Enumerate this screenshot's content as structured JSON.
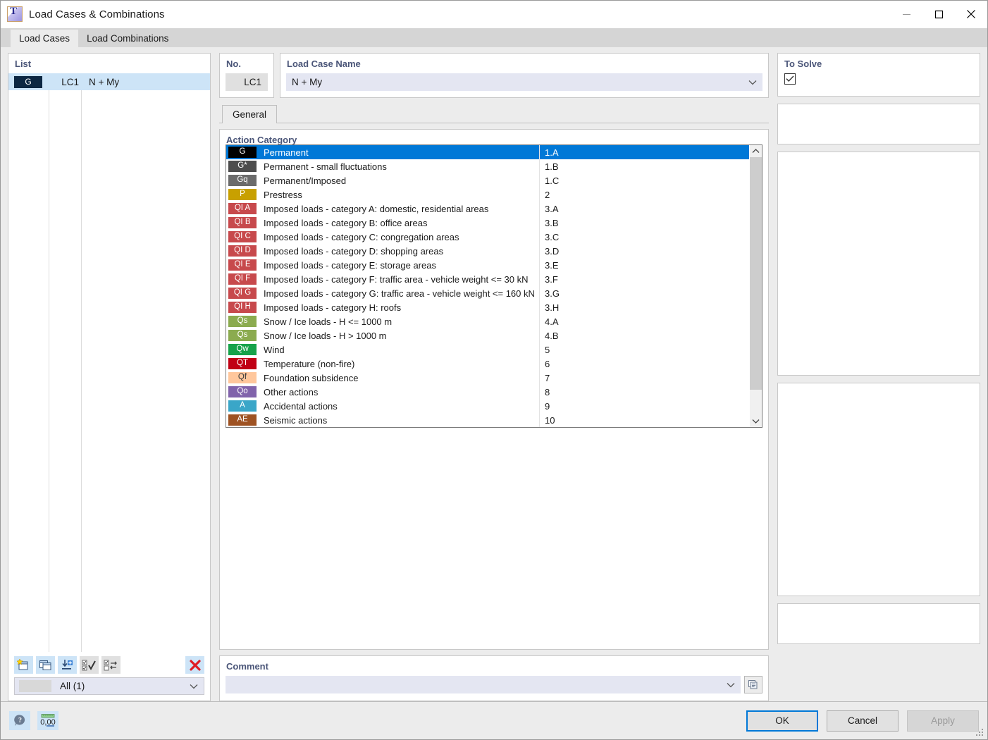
{
  "window": {
    "title": "Load Cases & Combinations",
    "icon": "app-icon",
    "minimize_label": "Minimize",
    "maximize_label": "Maximize",
    "close_label": "Close"
  },
  "tabs": [
    {
      "label": "Load Cases",
      "active": true
    },
    {
      "label": "Load Combinations",
      "active": false
    }
  ],
  "list": {
    "title": "List",
    "rows": [
      {
        "badge": "G",
        "badge_color": "#0d2742",
        "no": "LC1",
        "name": "N + My"
      }
    ],
    "toolbar": [
      {
        "name": "new-load-case-button",
        "icon": "new-window-star-icon"
      },
      {
        "name": "copy-load-case-button",
        "icon": "copy-windows-icon"
      },
      {
        "name": "import-load-case-button",
        "icon": "import-arrow-plus-icon"
      },
      {
        "name": "select-all-button",
        "icon": "checklist-check-icon"
      },
      {
        "name": "invert-selection-button",
        "icon": "checklist-swap-icon"
      },
      {
        "name": "delete-load-case-button",
        "icon": "red-x-icon"
      }
    ],
    "filter": {
      "value": "All (1)"
    }
  },
  "no_panel": {
    "title": "No.",
    "value": "LC1"
  },
  "name_panel": {
    "title": "Load Case Name",
    "value": "N + My"
  },
  "to_solve": {
    "title": "To Solve",
    "checked": true
  },
  "inner_tabs": [
    {
      "label": "General",
      "active": true
    }
  ],
  "action_category": {
    "title": "Action Category",
    "selected": {
      "badge": "G",
      "badge_color": "#000000",
      "label": "Permanent",
      "code": "1.A"
    },
    "options": [
      {
        "badge": "G",
        "badge_color": "#000000",
        "text_color": "#ffffff",
        "label": "Permanent",
        "code": "1.A",
        "selected": true
      },
      {
        "badge": "G*",
        "badge_color": "#4d4d4d",
        "text_color": "#ffffff",
        "label": "Permanent - small fluctuations",
        "code": "1.B",
        "selected": false
      },
      {
        "badge": "Gq",
        "badge_color": "#6b6b6b",
        "text_color": "#ffffff",
        "label": "Permanent/Imposed",
        "code": "1.C",
        "selected": false
      },
      {
        "badge": "P",
        "badge_color": "#c8a000",
        "text_color": "#ffffff",
        "label": "Prestress",
        "code": "2",
        "selected": false
      },
      {
        "badge": "QI A",
        "badge_color": "#c7494c",
        "text_color": "#ffffff",
        "label": "Imposed loads - category A: domestic, residential areas",
        "code": "3.A",
        "selected": false
      },
      {
        "badge": "QI B",
        "badge_color": "#c7494c",
        "text_color": "#ffffff",
        "label": "Imposed loads - category B: office areas",
        "code": "3.B",
        "selected": false
      },
      {
        "badge": "QI C",
        "badge_color": "#c7494c",
        "text_color": "#ffffff",
        "label": "Imposed loads - category C: congregation areas",
        "code": "3.C",
        "selected": false
      },
      {
        "badge": "QI D",
        "badge_color": "#c7494c",
        "text_color": "#ffffff",
        "label": "Imposed loads - category D: shopping areas",
        "code": "3.D",
        "selected": false
      },
      {
        "badge": "QI E",
        "badge_color": "#c7494c",
        "text_color": "#ffffff",
        "label": "Imposed loads - category E: storage areas",
        "code": "3.E",
        "selected": false
      },
      {
        "badge": "QI F",
        "badge_color": "#c7494c",
        "text_color": "#ffffff",
        "label": "Imposed loads - category F: traffic area - vehicle weight <= 30 kN",
        "code": "3.F",
        "selected": false
      },
      {
        "badge": "QI G",
        "badge_color": "#c7494c",
        "text_color": "#ffffff",
        "label": "Imposed loads - category G: traffic area - vehicle weight <= 160 kN",
        "code": "3.G",
        "selected": false
      },
      {
        "badge": "QI H",
        "badge_color": "#c7494c",
        "text_color": "#ffffff",
        "label": "Imposed loads - category H: roofs",
        "code": "3.H",
        "selected": false
      },
      {
        "badge": "Qs",
        "badge_color": "#8bab4f",
        "text_color": "#ffffff",
        "label": "Snow / Ice loads - H <= 1000 m",
        "code": "4.A",
        "selected": false
      },
      {
        "badge": "Qs",
        "badge_color": "#8bab4f",
        "text_color": "#ffffff",
        "label": "Snow / Ice loads - H > 1000 m",
        "code": "4.B",
        "selected": false
      },
      {
        "badge": "Qw",
        "badge_color": "#16a34a",
        "text_color": "#ffffff",
        "label": "Wind",
        "code": "5",
        "selected": false
      },
      {
        "badge": "QT",
        "badge_color": "#c00014",
        "text_color": "#ffffff",
        "label": "Temperature (non-fire)",
        "code": "6",
        "selected": false
      },
      {
        "badge": "Qf",
        "badge_color": "#ffc79c",
        "text_color": "#3a3a3a",
        "label": "Foundation subsidence",
        "code": "7",
        "selected": false
      },
      {
        "badge": "Qo",
        "badge_color": "#8163ab",
        "text_color": "#ffffff",
        "label": "Other actions",
        "code": "8",
        "selected": false
      },
      {
        "badge": "A",
        "badge_color": "#3aa6c8",
        "text_color": "#ffffff",
        "label": "Accidental actions",
        "code": "9",
        "selected": false
      },
      {
        "badge": "AE",
        "badge_color": "#9e5222",
        "text_color": "#ffffff",
        "label": "Seismic actions",
        "code": "10",
        "selected": false
      }
    ]
  },
  "comment": {
    "title": "Comment",
    "value": "",
    "button_icon": "copy-comment-icon"
  },
  "footer": {
    "help_icon": "help-balloon-icon",
    "units_icon": "units-ruler-icon",
    "ok_label": "OK",
    "cancel_label": "Cancel",
    "apply_label": "Apply",
    "apply_disabled": true
  },
  "colors": {
    "accent": "#0078d7",
    "selection_light": "#cde4f7",
    "panel_title": "#4a5578",
    "field_bg": "#e4e6f2",
    "dialog_bg": "#ececec"
  }
}
